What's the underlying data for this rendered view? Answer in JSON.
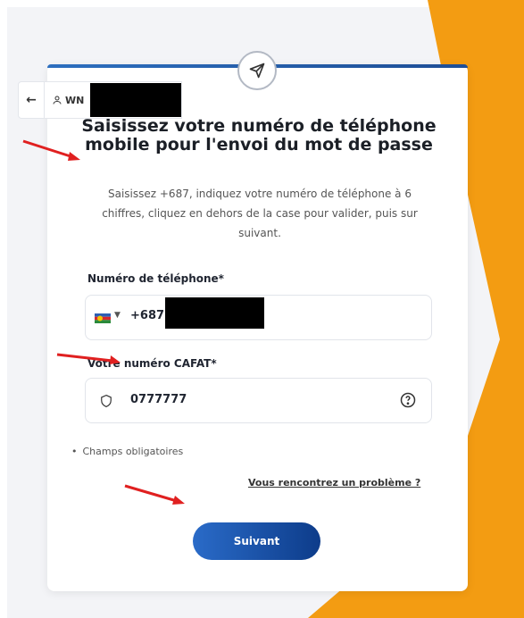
{
  "header": {
    "back_icon": "arrow-left-icon",
    "user_prefix": "WN"
  },
  "form": {
    "title": "Saisissez votre numéro de téléphone mobile pour l'envoi du mot de passe",
    "subtitle": "Saisissez +687, indiquez votre numéro de téléphone à 6 chiffres, cliquez en dehors de la case pour valider, puis sur suivant.",
    "phone_label": "Numéro de téléphone*",
    "phone_prefix": "+687",
    "cafat_label": "Votre numéro CAFAT*",
    "cafat_value": "0777777",
    "required_note": "Champs obligatoires",
    "help_link": "Vous rencontrez un problème ?",
    "next_button": "Suivant"
  },
  "colors": {
    "orange_accent": "#f39c12",
    "button_blue": "#1e56a8",
    "annotation_red": "#e02020"
  }
}
